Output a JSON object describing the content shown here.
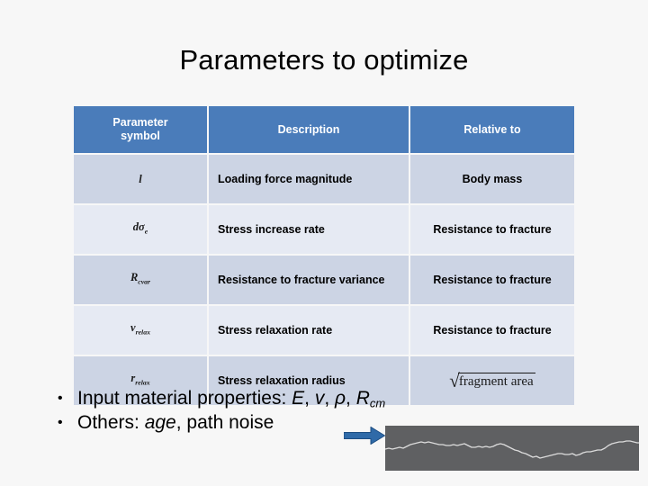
{
  "slide": {
    "title": "Parameters to optimize"
  },
  "table": {
    "headers": [
      "Parameter symbol",
      "Description",
      "Relative to"
    ],
    "header_labels": {
      "col1_line1": "Parameter",
      "col1_line2": "symbol",
      "col2": "Description",
      "col3": "Relative to"
    },
    "rows": [
      {
        "symbol_text": "l",
        "symbol_base": "l",
        "symbol_sub": "",
        "description": "Loading force magnitude",
        "relative_to": "Body mass"
      },
      {
        "symbol_text": "dσe",
        "symbol_base": "dσ",
        "symbol_sub": "e",
        "description": "Stress increase rate",
        "relative_to": "Resistance to fracture"
      },
      {
        "symbol_text": "Rcvar",
        "symbol_base": "R",
        "symbol_sub": "cvar",
        "description": "Resistance to fracture variance",
        "relative_to": "Resistance to fracture"
      },
      {
        "symbol_text": "vrelax",
        "symbol_base": "v",
        "symbol_sub": "relax",
        "description": "Stress relaxation rate",
        "relative_to": "Resistance to fracture"
      },
      {
        "symbol_text": "rrelax",
        "symbol_base": "r",
        "symbol_sub": "relax",
        "description": "Stress relaxation radius",
        "relative_to_formula": {
          "radical": "√",
          "radicand": "fragment area"
        }
      }
    ]
  },
  "bullets": [
    {
      "prefix": "Input material properties: ",
      "values_plain": "E, v, ρ, R",
      "values": [
        {
          "text": "E",
          "italic": true
        },
        {
          "text": "v",
          "italic": true
        },
        {
          "text": "ρ",
          "italic": true
        },
        {
          "text": "R",
          "italic": true,
          "sub": "cm"
        }
      ]
    },
    {
      "prefix": "Others: ",
      "emphasis": "age",
      "suffix": ", path noise"
    }
  ],
  "arrow": {
    "name": "right-arrow",
    "color": "#2f6aa8"
  },
  "image_panel": {
    "name": "path-noise-preview",
    "background": "#5f6062",
    "line_color": "#dcdcdc"
  },
  "colors": {
    "background": "#f7f7f7",
    "header_blue": "#4a7cba",
    "row_dark": "#ccd4e4",
    "row_light": "#e6eaf3",
    "text": "#000000"
  }
}
